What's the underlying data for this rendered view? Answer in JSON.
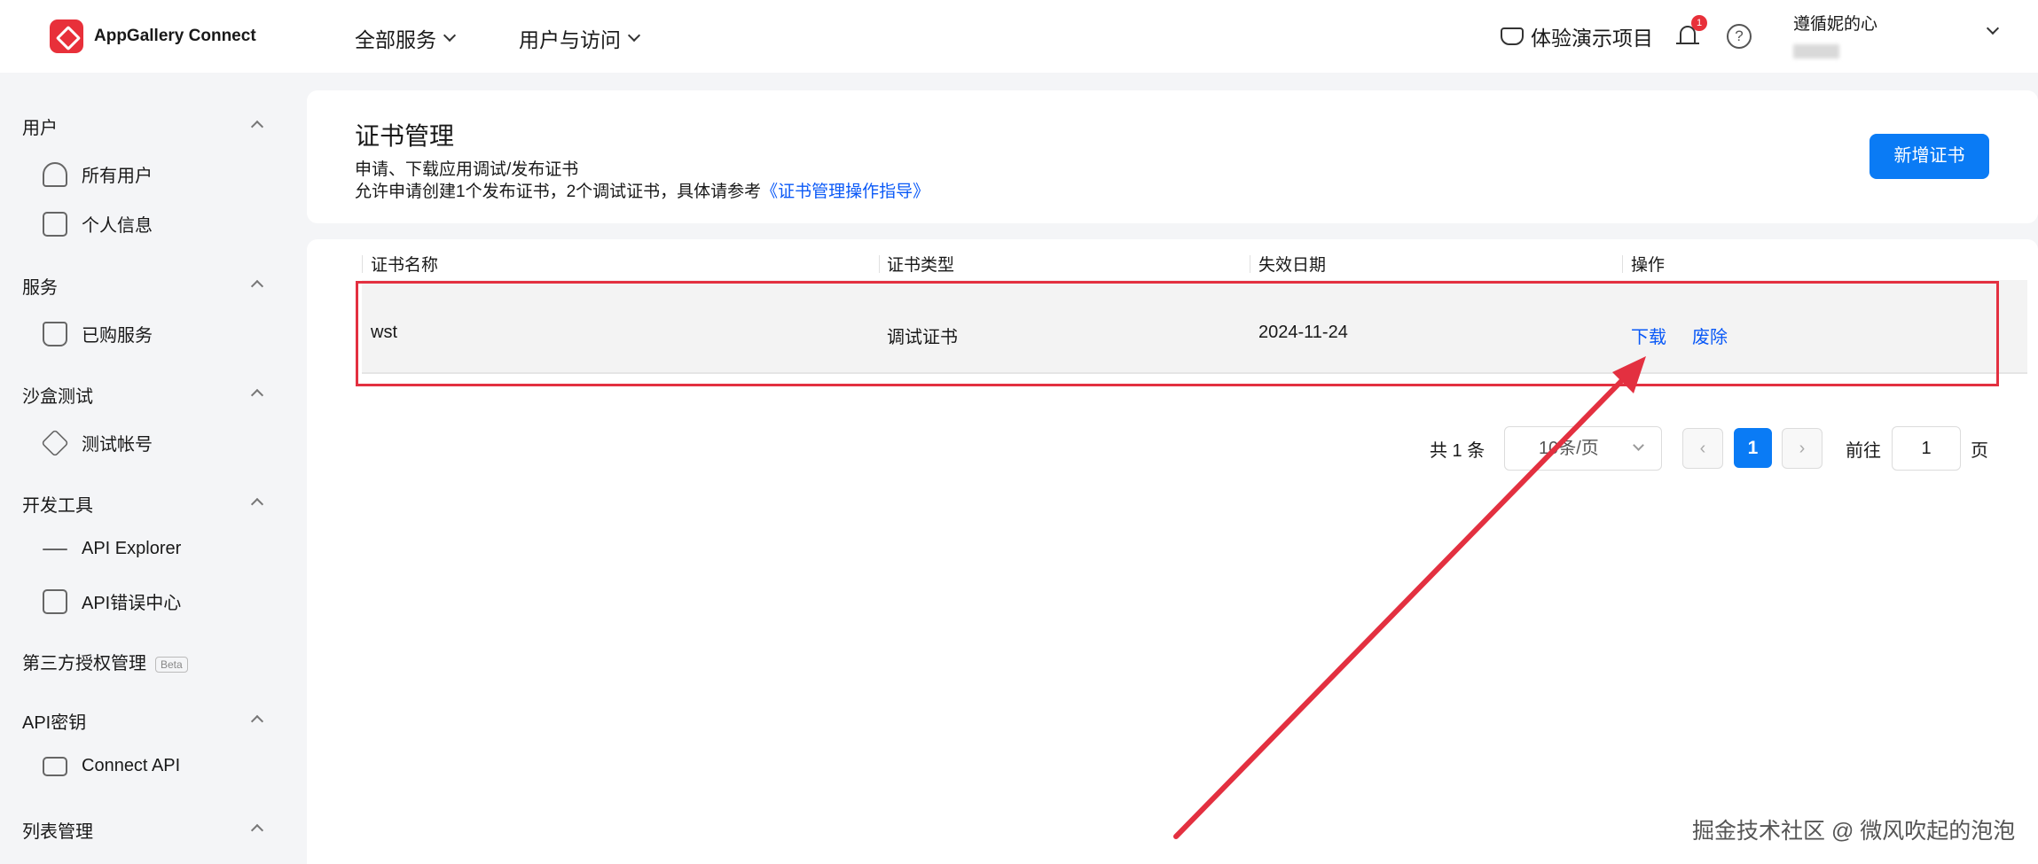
{
  "brand": {
    "name": "AppGallery Connect"
  },
  "topnav": {
    "all_services": "全部服务",
    "users_access": "用户与访问"
  },
  "topright": {
    "demo": "体验演示项目",
    "notification_count": "1",
    "help": "?",
    "user_name": "遵循妮的心"
  },
  "sidebar": {
    "users": "用户",
    "all_users": "所有用户",
    "personal_info": "个人信息",
    "services": "服务",
    "purchased": "已购服务",
    "sandbox": "沙盒测试",
    "test_account": "测试帐号",
    "devtools": "开发工具",
    "api_explorer": "API Explorer",
    "api_errors": "API错误中心",
    "third_party": "第三方授权管理",
    "beta": "Beta",
    "api_keys": "API密钥",
    "connect_api": "Connect API",
    "list_mgmt": "列表管理"
  },
  "page": {
    "title": "证书管理",
    "desc1": "申请、下载应用调试/发布证书",
    "desc2": "允许申请创建1个发布证书，2个调试证书，具体请参考",
    "guide_link": "《证书管理操作指导》",
    "add_button": "新增证书"
  },
  "table": {
    "headers": [
      "证书名称",
      "证书类型",
      "失效日期",
      "操作"
    ],
    "rows": [
      {
        "name": "wst",
        "type": "调试证书",
        "expiry": "2024-11-24",
        "download": "下载",
        "revoke": "废除"
      }
    ]
  },
  "pagination": {
    "total": "共 1 条",
    "page_size": "10条/页",
    "prev": "‹",
    "current": "1",
    "next": "›",
    "goto": "前往",
    "goto_value": "1",
    "page_suffix": "页"
  },
  "watermark": "掘金技术社区 @ 微风吹起的泡泡",
  "colors": {
    "accent": "#0a7bf5",
    "link": "#0a59f7",
    "brand": "#e8303a",
    "annotation": "#e33040"
  },
  "icons": [
    "logo-mark-icon",
    "chevron-down-icon",
    "demo-icon",
    "bell-icon",
    "help-icon",
    "users-all-icon",
    "profile-icon",
    "bag-icon",
    "cube-icon",
    "api-explorer-icon",
    "api-error-icon",
    "connect-api-icon",
    "chevron-up-icon"
  ]
}
